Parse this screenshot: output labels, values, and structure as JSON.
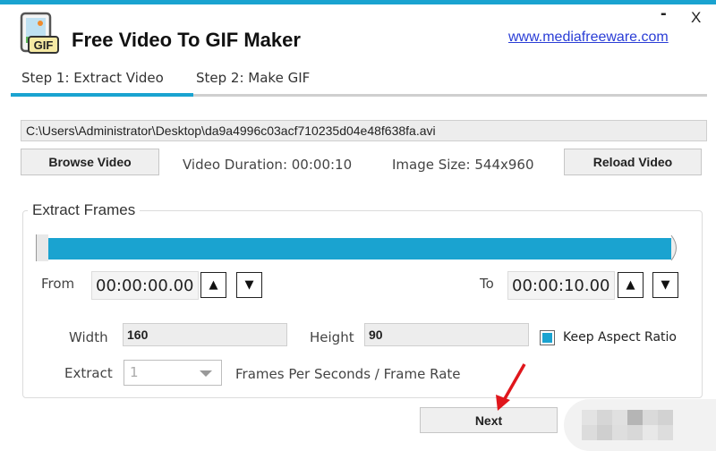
{
  "window": {
    "title": "Free Video To GIF Maker",
    "website_link": "www.mediafreeware.com",
    "minimize_label": "-",
    "close_label": "X",
    "icon_label": "GIF"
  },
  "tabs": [
    {
      "label": "Step 1: Extract Video",
      "active": true
    },
    {
      "label": "Step 2: Make GIF",
      "active": false
    }
  ],
  "file": {
    "path": "C:\\Users\\Administrator\\Desktop\\da9a4996c03acf710235d04e48f638fa.avi",
    "browse_label": "Browse Video",
    "reload_label": "Reload Video",
    "duration_text": "Video Duration: 00:00:10",
    "image_size_text": "Image Size: 544x960"
  },
  "extract_frames": {
    "title": "Extract Frames",
    "range_start_fraction": 0.0,
    "range_end_fraction": 1.0,
    "from_label": "From",
    "from_value": "00:00:00.00",
    "to_label": "To",
    "to_value": "00:00:10.00",
    "up_glyph": "▲",
    "down_glyph": "▼",
    "width_label": "Width",
    "width_value": "160",
    "height_label": "Height",
    "height_value": "90",
    "keep_aspect_label": "Keep Aspect Ratio",
    "keep_aspect_checked": true,
    "extract_label": "Extract",
    "extract_value": "1",
    "frame_rate_label": "Frames Per Seconds / Frame Rate"
  },
  "footer": {
    "next_label": "Next"
  },
  "colors": {
    "accent": "#1aa3d0",
    "annotation_arrow": "#e0161c"
  }
}
